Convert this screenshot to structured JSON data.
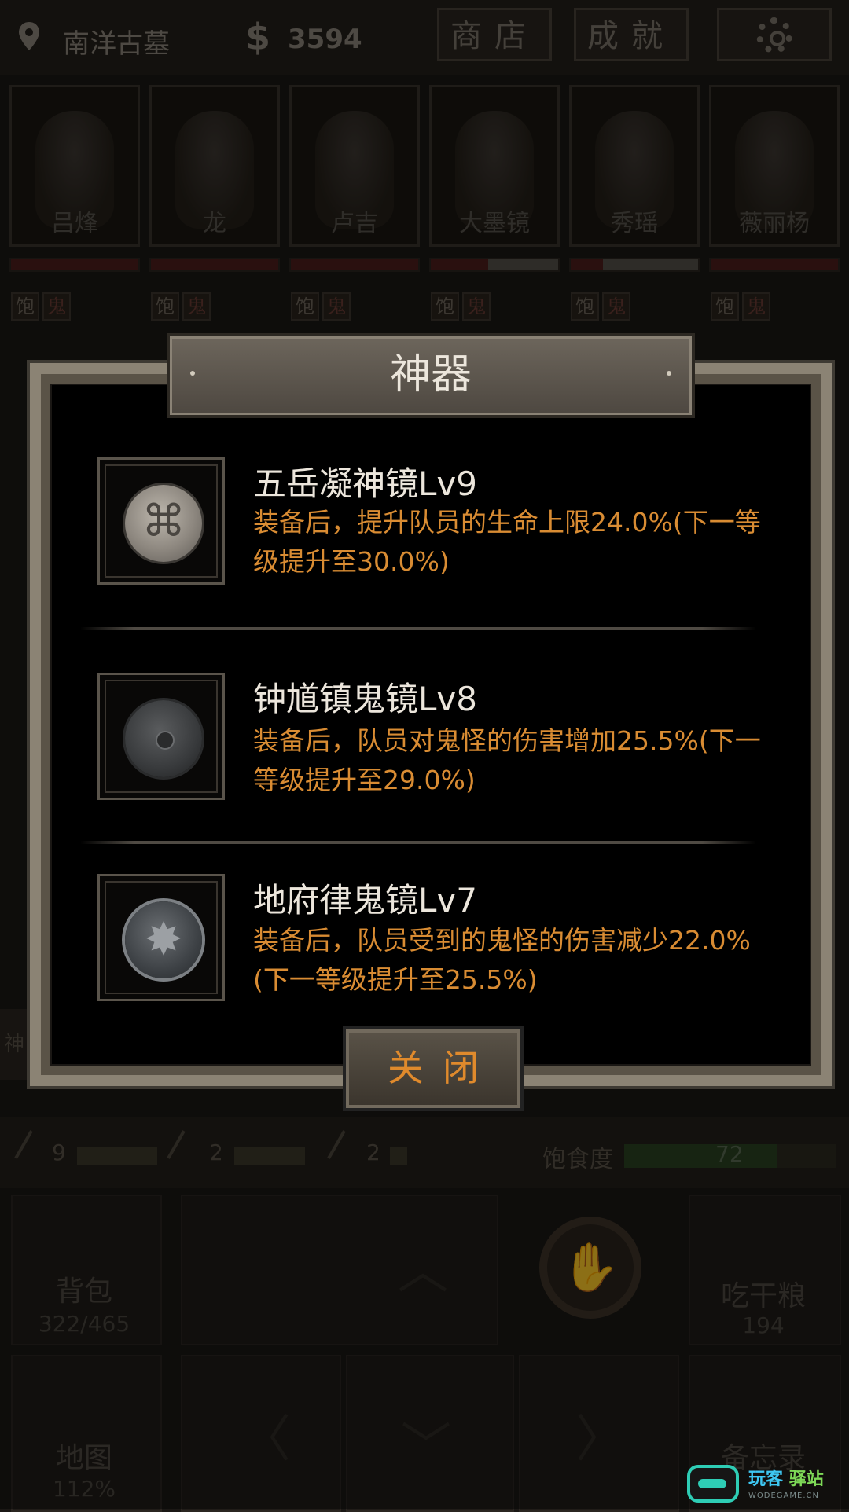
{
  "topbar": {
    "location": "南洋古墓",
    "money_symbol": "$",
    "money": "3594",
    "shop_label": "商店",
    "achievements_label": "成就",
    "settings_icon": "gear-icon"
  },
  "characters": [
    {
      "name": "吕烽",
      "hp": 1.0
    },
    {
      "name": "龙",
      "hp": 1.0
    },
    {
      "name": "卢吉",
      "hp": 1.0
    },
    {
      "name": "大墨镜",
      "hp": 0.45
    },
    {
      "name": "秀瑶",
      "hp": 0.25
    },
    {
      "name": "薇丽杨",
      "hp": 1.0
    }
  ],
  "status_tags": {
    "full": "饱",
    "ghost": "鬼"
  },
  "side_tab": "神",
  "resources": {
    "axe_count": "9",
    "pick_count": "2",
    "shovel_count": "2",
    "satiety_label": "饱食度",
    "satiety_value": "72"
  },
  "actions": {
    "bag_label": "背包",
    "bag_count": "322/465",
    "ration_label": "吃干粮",
    "ration_count": "194",
    "map_label": "地图",
    "map_percent": "112%",
    "memo_label": "备忘录"
  },
  "modal": {
    "title": "神器",
    "items": [
      {
        "name": "五岳凝神镜Lv9",
        "desc": "装备后，提升队员的生命上限24.0%(下一等级提升至30.0%)",
        "icon": "silver-mirror-icon"
      },
      {
        "name": "钟馗镇鬼镜Lv8",
        "desc": "装备后，队员对鬼怪的伤害增加25.5%(下一等级提升至29.0%)",
        "icon": "bronze-mirror-icon"
      },
      {
        "name": "地府律鬼镜Lv7",
        "desc": "装备后，队员受到的鬼怪的伤害减少22.0%(下一等级提升至25.5%)",
        "icon": "star-mirror-icon"
      }
    ],
    "close_label": "关闭"
  },
  "watermark": {
    "text_a": "玩客",
    "text_b": "驿站",
    "sub": "WODEGAME.CN"
  }
}
